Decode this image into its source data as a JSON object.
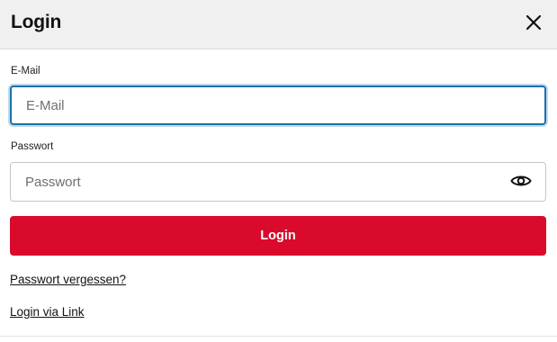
{
  "header": {
    "title": "Login",
    "close_icon": "close-icon"
  },
  "email": {
    "label": "E-Mail",
    "placeholder": "E-Mail",
    "value": ""
  },
  "password": {
    "label": "Passwort",
    "placeholder": "Passwort",
    "value": "",
    "toggle_icon": "eye-icon"
  },
  "actions": {
    "login_label": "Login",
    "forgot_password": "Passwort vergessen?",
    "login_via_link": "Login via Link"
  },
  "colors": {
    "primary": "#d90a2c",
    "focus_border": "#1f6fa8",
    "header_bg": "#f0f0f0"
  }
}
